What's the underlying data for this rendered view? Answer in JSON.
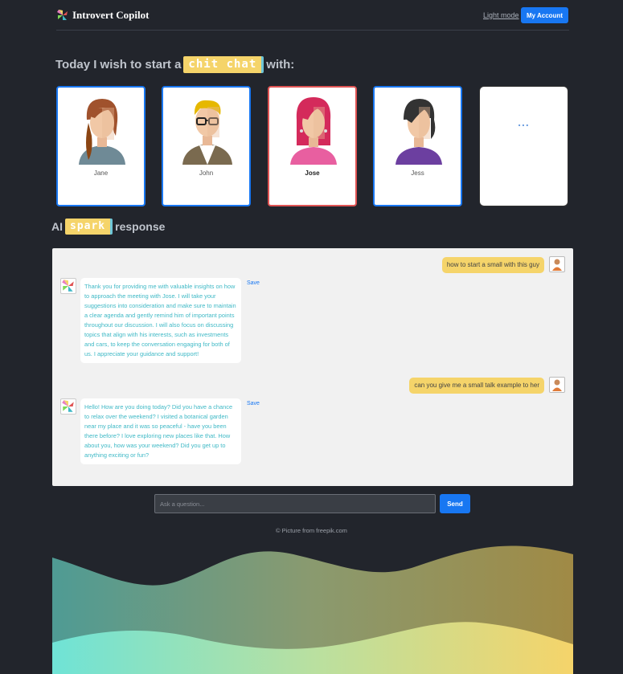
{
  "header": {
    "app_name": "Introvert Copilot",
    "light_mode_label": "Light mode",
    "account_label": "My Account"
  },
  "intro": {
    "prefix": "Today I wish to start a",
    "highlight": "chit chat",
    "suffix": "with:"
  },
  "personas": [
    {
      "name": "Jane",
      "selected": false
    },
    {
      "name": "John",
      "selected": false
    },
    {
      "name": "Jose",
      "selected": true
    },
    {
      "name": "Jess",
      "selected": false
    },
    {
      "name": "",
      "more_label": "..."
    }
  ],
  "response_section": {
    "prefix": "AI",
    "highlight": "spark",
    "suffix": "response"
  },
  "chat": {
    "messages": [
      {
        "role": "user",
        "text": "how to start a small with this guy"
      },
      {
        "role": "ai",
        "text": "Thank you for providing me with valuable insights on how to approach the meeting with Jose. I will take your suggestions into consideration and make sure to maintain a clear agenda and gently remind him of important points throughout our discussion. I will also focus on discussing topics that align with his interests, such as investments and cars, to keep the conversation engaging for both of us. I appreciate your guidance and support!",
        "save_label": "Save"
      },
      {
        "role": "user",
        "text": "can you give me a small talk example to her"
      },
      {
        "role": "ai",
        "text": "Hello! How are you doing today? Did you have a chance to relax over the weekend? I visited a botanical garden near my place and it was so peaceful - have you been there before? I love exploring new places like that. How about you, how was your weekend? Did you get up to anything exciting or fun?",
        "save_label": "Save"
      }
    ]
  },
  "input": {
    "placeholder": "Ask a question...",
    "send_label": "Send"
  },
  "footer": {
    "credit": "© Picture from freepik.com"
  },
  "colors": {
    "background": "#22252c",
    "accent": "#1877f2",
    "highlight": "#f5d46a",
    "selected_border": "#e05454",
    "ai_text": "#3fb9c6"
  }
}
